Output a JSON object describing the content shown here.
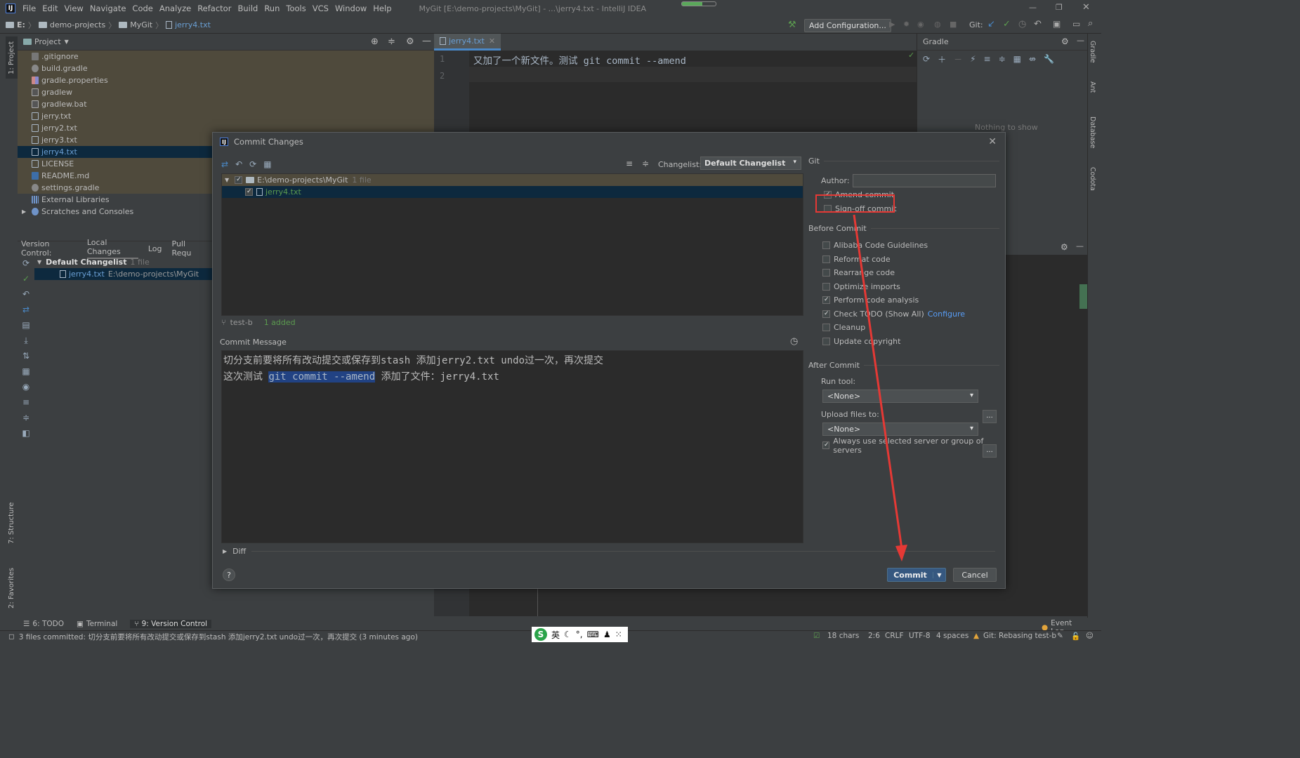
{
  "menubar": {
    "logo": "IJ",
    "items": [
      "File",
      "Edit",
      "View",
      "Navigate",
      "Code",
      "Analyze",
      "Refactor",
      "Build",
      "Run",
      "Tools",
      "VCS",
      "Window",
      "Help"
    ],
    "window_title": "MyGit [E:\\demo-projects\\MyGit] - ...\\jerry4.txt - IntelliJ IDEA"
  },
  "navbar": {
    "crumbs": [
      "E:",
      "demo-projects",
      "MyGit",
      "jerry4.txt"
    ],
    "add_config": "Add Configuration...",
    "git_label": "Git:"
  },
  "left_tabs": {
    "project": "1: Project",
    "structure": "7: Structure",
    "favorites": "2: Favorites"
  },
  "right_tabs": {
    "gradle": "Gradle",
    "ant": "Ant",
    "database": "Database",
    "codota": "Codota"
  },
  "project_panel": {
    "title": "Project",
    "items": [
      ".gitignore",
      "build.gradle",
      "gradle.properties",
      "gradlew",
      "gradlew.bat",
      "jerry.txt",
      "jerry2.txt",
      "jerry3.txt",
      "jerry4.txt",
      "LICENSE",
      "README.md",
      "settings.gradle",
      "External Libraries",
      "Scratches and Consoles"
    ]
  },
  "editor": {
    "tab": "jerry4.txt",
    "lines": [
      "1",
      "2"
    ],
    "line1": "又加了一个新文件。测试 git commit --amend"
  },
  "gradle_panel": {
    "title": "Gradle",
    "empty": "Nothing to show"
  },
  "version_control": {
    "label": "Version Control:",
    "tabs": [
      "Local Changes",
      "Log",
      "Pull Requ"
    ],
    "changelist": "Default Changelist",
    "changelist_count": "1 file",
    "file": "jerry4.txt",
    "file_path": "E:\\demo-projects\\MyGit"
  },
  "dialog": {
    "title": "Commit Changes",
    "changelist_label": "Changelist:",
    "changelist_value": "Default Changelist",
    "root_path": "E:\\demo-projects\\MyGit",
    "root_count": "1 file",
    "file": "jerry4.txt",
    "branch": "test-b",
    "added": "1 added",
    "commit_message_label": "Commit Message",
    "msg_line1": "切分支前要将所有改动提交或保存到stash 添加jerry2.txt undo过一次，再次提交",
    "msg_line2_pre": "这次测试 ",
    "msg_line2_hl": "git commit --amend",
    "msg_line2_post": " 添加了文件：jerry4.txt",
    "diff_label": "Diff",
    "help": "?",
    "commit_button": "Commit",
    "cancel_button": "Cancel",
    "git_section": "Git",
    "author_label": "Author:",
    "author_value": "",
    "amend_commit": "Amend commit",
    "signoff_commit": "Sign-off commit",
    "before_commit": "Before Commit",
    "before_options": [
      "Alibaba Code Guidelines",
      "Reformat code",
      "Rearrange code",
      "Optimize imports",
      "Perform code analysis",
      "Check TODO (Show All)",
      "Cleanup",
      "Update copyright"
    ],
    "configure_link": "Configure",
    "after_commit": "After Commit",
    "run_tool_label": "Run tool:",
    "run_tool_value": "<None>",
    "upload_label": "Upload files to:",
    "upload_value": "<None>",
    "always_use": "Always use selected server or group of servers",
    "dots": "..."
  },
  "toolwindows": [
    "6: TODO",
    "Terminal",
    "9: Version Control"
  ],
  "event_log": "Event Log",
  "statusbar": {
    "message": "3 files committed: 切分支前要将所有改动提交或保存到stash 添加jerry2.txt undo过一次，再次提交 (3 minutes ago)",
    "ime": "英",
    "chars": "18 chars",
    "pos": "2:6",
    "crlf": "CRLF",
    "encoding": "UTF-8",
    "indent": "4 spaces",
    "git": "Git: Rebasing test-b"
  },
  "colors": {
    "accent": "#365880",
    "annotation": "#e53935",
    "selection": "#0d293e"
  }
}
